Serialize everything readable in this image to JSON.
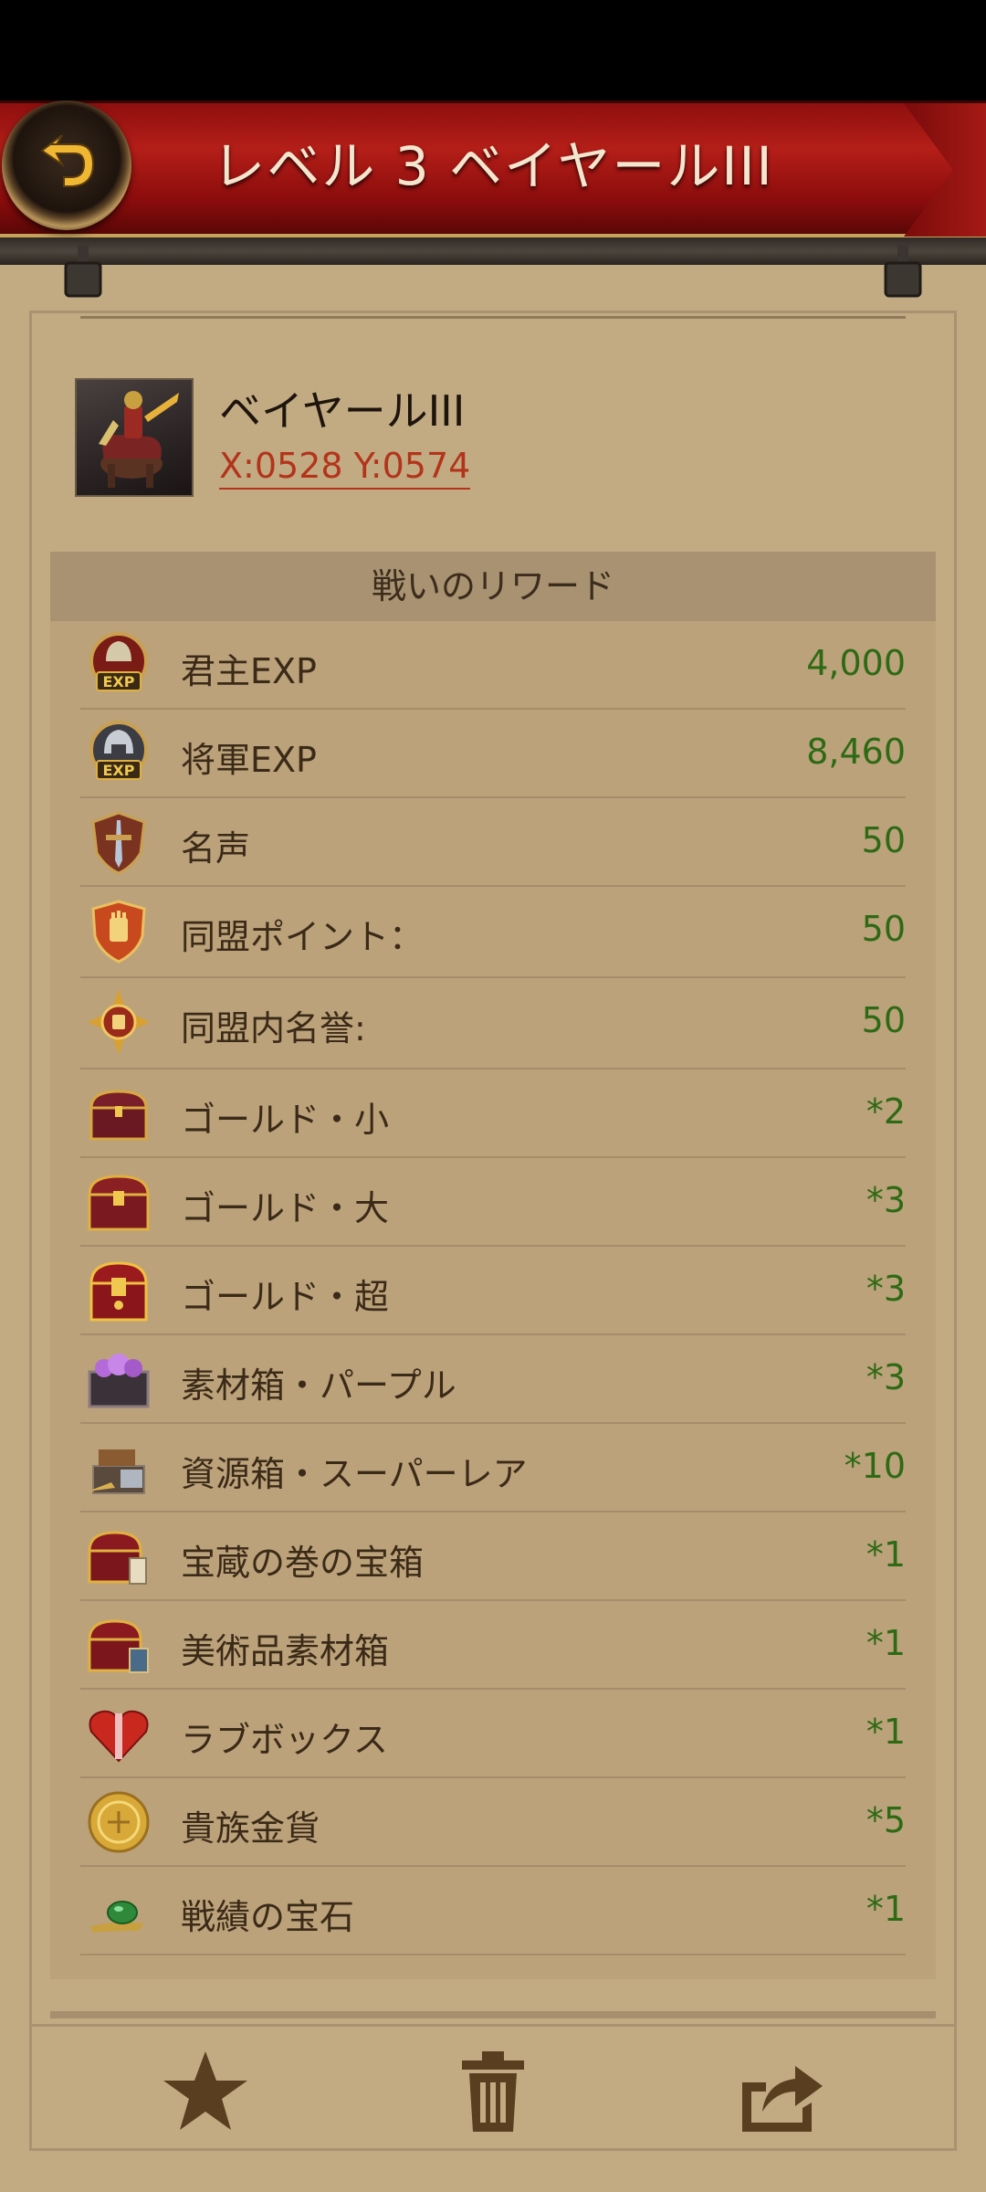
{
  "header": {
    "title": "レベル 3 ベイヤールIII"
  },
  "target": {
    "name": "ベイヤールIII",
    "coords": "X:0528 Y:0574"
  },
  "rewards": {
    "title": "戦いのリワード",
    "items": [
      {
        "icon": "lord-exp-icon",
        "label": "君主EXP",
        "value": "4,000"
      },
      {
        "icon": "general-exp-icon",
        "label": "将軍EXP",
        "value": "8,460"
      },
      {
        "icon": "fame-icon",
        "label": "名声",
        "value": "50"
      },
      {
        "icon": "alliance-points-icon",
        "label": "同盟ポイント：",
        "value": "50"
      },
      {
        "icon": "alliance-honor-icon",
        "label": "同盟内名誉:",
        "value": "50"
      },
      {
        "icon": "gold-chest-small-icon",
        "label": "ゴールド・小",
        "value": "*2"
      },
      {
        "icon": "gold-chest-large-icon",
        "label": "ゴールド・大",
        "value": "*3"
      },
      {
        "icon": "gold-chest-super-icon",
        "label": "ゴールド・超",
        "value": "*3"
      },
      {
        "icon": "purple-material-box-icon",
        "label": "素材箱・パープル",
        "value": "*3"
      },
      {
        "icon": "resource-box-icon",
        "label": "資源箱・スーパーレア",
        "value": "*10"
      },
      {
        "icon": "treasure-scroll-chest-icon",
        "label": "宝蔵の巻の宝箱",
        "value": "*1"
      },
      {
        "icon": "art-material-box-icon",
        "label": "美術品素材箱",
        "value": "*1"
      },
      {
        "icon": "love-box-icon",
        "label": "ラブボックス",
        "value": "*1"
      },
      {
        "icon": "noble-coin-icon",
        "label": "貴族金貨",
        "value": "*5"
      },
      {
        "icon": "merit-gem-icon",
        "label": "戦績の宝石",
        "value": "*1"
      }
    ]
  },
  "toolbar": {
    "items": [
      "favorite-star-icon",
      "delete-trash-icon",
      "share-icon"
    ]
  },
  "colors": {
    "background": "#c2ab83",
    "header_red": "#a51a15",
    "value_green": "#2e6a15",
    "coord_red": "#b3341b",
    "icon_brown": "#5a3e20"
  }
}
